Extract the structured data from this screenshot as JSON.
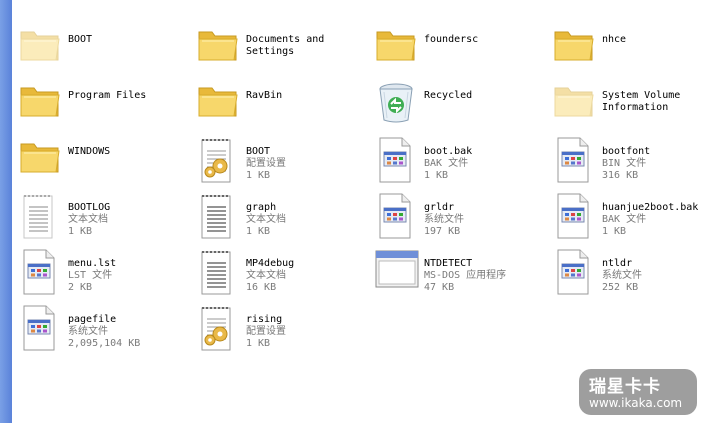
{
  "files": [
    {
      "name": "BOOT",
      "icon": "folder-faded-icon"
    },
    {
      "name": "Documents and\nSettings",
      "icon": "folder-icon"
    },
    {
      "name": "foundersc",
      "icon": "folder-icon"
    },
    {
      "name": "nhce",
      "icon": "folder-icon"
    },
    {
      "name": "Program Files",
      "icon": "folder-icon"
    },
    {
      "name": "RavBin",
      "icon": "folder-icon"
    },
    {
      "name": "Recycled",
      "icon": "recycle-bin-icon"
    },
    {
      "name": "System Volume\nInformation",
      "icon": "folder-faded-icon"
    },
    {
      "name": "WINDOWS",
      "icon": "folder-icon"
    },
    {
      "name": "BOOT",
      "type": "配置设置",
      "size": "1 KB",
      "icon": "config-file-icon"
    },
    {
      "name": "boot.bak",
      "type": "BAK 文件",
      "size": "1 KB",
      "icon": "system-file-icon"
    },
    {
      "name": "bootfont",
      "type": "BIN 文件",
      "size": "316 KB",
      "icon": "system-file-icon"
    },
    {
      "name": "BOOTLOG",
      "type": "文本文档",
      "size": "1 KB",
      "icon": "text-file-faded-icon"
    },
    {
      "name": "graph",
      "type": "文本文档",
      "size": "1 KB",
      "icon": "text-file-icon"
    },
    {
      "name": "grldr",
      "type": "系统文件",
      "size": "197 KB",
      "icon": "system-file-icon"
    },
    {
      "name": "huanjue2boot.bak",
      "type": "BAK 文件",
      "size": "1 KB",
      "icon": "system-file-icon"
    },
    {
      "name": "menu.lst",
      "type": "LST 文件",
      "size": "2 KB",
      "icon": "system-file-icon"
    },
    {
      "name": "MP4debug",
      "type": "文本文档",
      "size": "16 KB",
      "icon": "text-file-icon"
    },
    {
      "name": "NTDETECT",
      "type": "MS-DOS 应用程序",
      "size": "47 KB",
      "icon": "msdos-app-icon"
    },
    {
      "name": "ntldr",
      "type": "系统文件",
      "size": "252 KB",
      "icon": "system-file-icon"
    },
    {
      "name": "pagefile",
      "type": "系统文件",
      "size": "2,095,104 KB",
      "icon": "system-file-icon"
    },
    {
      "name": "rising",
      "type": "配置设置",
      "size": "1 KB",
      "icon": "config-file-icon"
    }
  ],
  "watermark": {
    "brand": "瑞星卡卡",
    "url": "www.ikaka.com"
  }
}
